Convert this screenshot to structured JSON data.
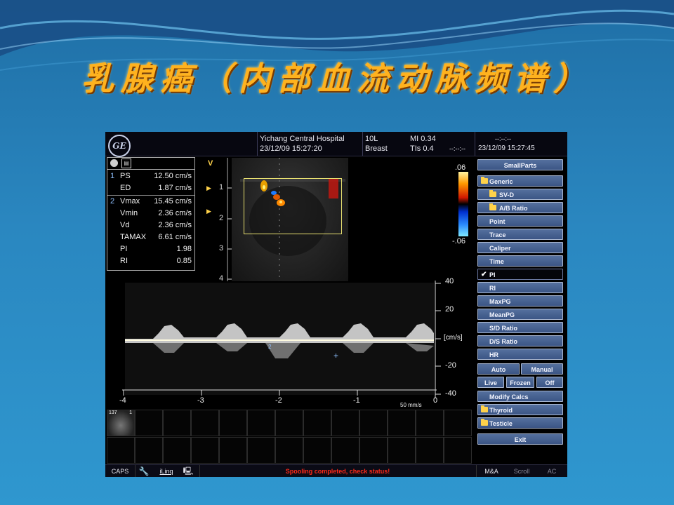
{
  "slide": {
    "title": "乳腺癌（内部血流动脉频谱）"
  },
  "header": {
    "logo_text": "GE",
    "hospital": "Yichang Central Hospital",
    "datetime_left": "23/12/09 15:27:20",
    "probe": "10L",
    "preset": "Breast",
    "mi": "MI 0.34",
    "tis": "TIs 0.4",
    "blank_right": "--:--:--",
    "time_right_top": "--:--:--",
    "datetime_right": "23/12/09 15:27:45"
  },
  "measurements": {
    "rows": [
      {
        "idx": "1",
        "label": "PS",
        "value": "12.50 cm/s"
      },
      {
        "idx": "",
        "label": "ED",
        "value": "1.87 cm/s"
      },
      {
        "idx": "2",
        "label": "Vmax",
        "value": "15.45 cm/s"
      },
      {
        "idx": "",
        "label": "Vmin",
        "value": "2.36 cm/s"
      },
      {
        "idx": "",
        "label": "Vd",
        "value": "2.36 cm/s"
      },
      {
        "idx": "",
        "label": "TAMAX",
        "value": "6.61 cm/s"
      },
      {
        "idx": "",
        "label": "PI",
        "value": "1.98"
      },
      {
        "idx": "",
        "label": "RI",
        "value": "0.85"
      }
    ]
  },
  "bmode": {
    "v_label": "V",
    "depth_ticks": [
      "1",
      "2",
      "3",
      "4"
    ]
  },
  "color_scale": {
    "top": ".06",
    "bottom": "-.06"
  },
  "spectral": {
    "y_labels": [
      "40",
      "20",
      "[cm/s]",
      "-20",
      "-40"
    ],
    "x_labels": [
      "-4",
      "-3",
      "-2",
      "-1",
      "0"
    ],
    "sweep": "50 mm/s",
    "marker_2": "2"
  },
  "thumbs": {
    "first_label": "137",
    "first_index": "1"
  },
  "panel": {
    "buttons": [
      {
        "label": "SmallParts",
        "icon": "none",
        "center": true
      },
      {
        "label": "Generic",
        "icon": "folder-open"
      },
      {
        "label": "SV-D",
        "icon": "folder",
        "indent": true
      },
      {
        "label": "A/B Ratio",
        "icon": "folder",
        "indent": true
      },
      {
        "label": "Point",
        "icon": "none"
      },
      {
        "label": "Trace",
        "icon": "none"
      },
      {
        "label": "Caliper",
        "icon": "none"
      },
      {
        "label": "Time",
        "icon": "none"
      },
      {
        "label": "PI",
        "icon": "check",
        "selected": true
      },
      {
        "label": "RI",
        "icon": "none"
      },
      {
        "label": "MaxPG",
        "icon": "none"
      },
      {
        "label": "MeanPG",
        "icon": "none"
      },
      {
        "label": "S/D Ratio",
        "icon": "none"
      },
      {
        "label": "D/S Ratio",
        "icon": "none"
      },
      {
        "label": "HR",
        "icon": "none"
      }
    ],
    "auto": "Auto",
    "manual": "Manual",
    "live": "Live",
    "frozen": "Frozen",
    "off": "Off",
    "modify_calcs": "Modify Calcs",
    "thyroid": "Thyroid",
    "testicle": "Testicle",
    "exit": "Exit"
  },
  "statusbar": {
    "caps": "CAPS",
    "iling": "iLinq",
    "status": "Spooling completed, check status!",
    "ma": "M&A",
    "scroll": "Scroll",
    "ac": "AC"
  }
}
